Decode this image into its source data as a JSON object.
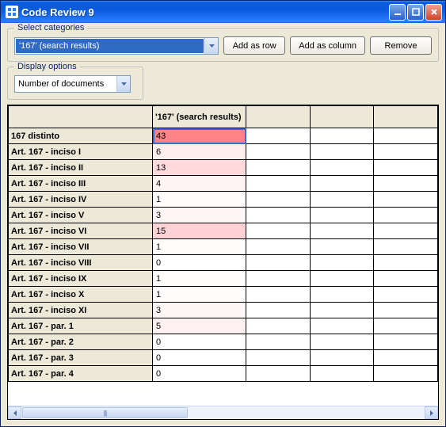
{
  "window": {
    "title": "Code Review 9"
  },
  "groups": {
    "categories_label": "Select categories",
    "display_label": "Display options"
  },
  "category_dropdown": {
    "selected": "'167' (search results)"
  },
  "buttons": {
    "add_row": "Add as row",
    "add_col": "Add as column",
    "remove": "Remove"
  },
  "display_dropdown": {
    "selected": "Number of documents"
  },
  "table": {
    "column_header": "'167' (search results)",
    "max_value": 43,
    "rows": [
      {
        "label": "167 distinto",
        "value": 43
      },
      {
        "label": "Art. 167 - inciso I",
        "value": 6
      },
      {
        "label": "Art. 167 - inciso II",
        "value": 13
      },
      {
        "label": "Art. 167 - inciso III",
        "value": 4
      },
      {
        "label": "Art. 167 - inciso IV",
        "value": 1
      },
      {
        "label": "Art. 167 - inciso V",
        "value": 3
      },
      {
        "label": "Art. 167 - inciso VI",
        "value": 15
      },
      {
        "label": "Art. 167 - inciso VII",
        "value": 1
      },
      {
        "label": "Art. 167 - inciso VIII",
        "value": 0
      },
      {
        "label": "Art. 167 - inciso IX",
        "value": 1
      },
      {
        "label": "Art. 167 - inciso X",
        "value": 1
      },
      {
        "label": "Art. 167 - inciso XI",
        "value": 3
      },
      {
        "label": "Art. 167 - par. 1",
        "value": 5
      },
      {
        "label": "Art. 167 - par. 2",
        "value": 0
      },
      {
        "label": "Art. 167 - par. 3",
        "value": 0
      },
      {
        "label": "Art. 167 - par. 4",
        "value": 0
      }
    ]
  },
  "heat_color": {
    "base_r": 255,
    "base_g": 110,
    "base_b": 115,
    "blend_to": "#ffffff"
  }
}
